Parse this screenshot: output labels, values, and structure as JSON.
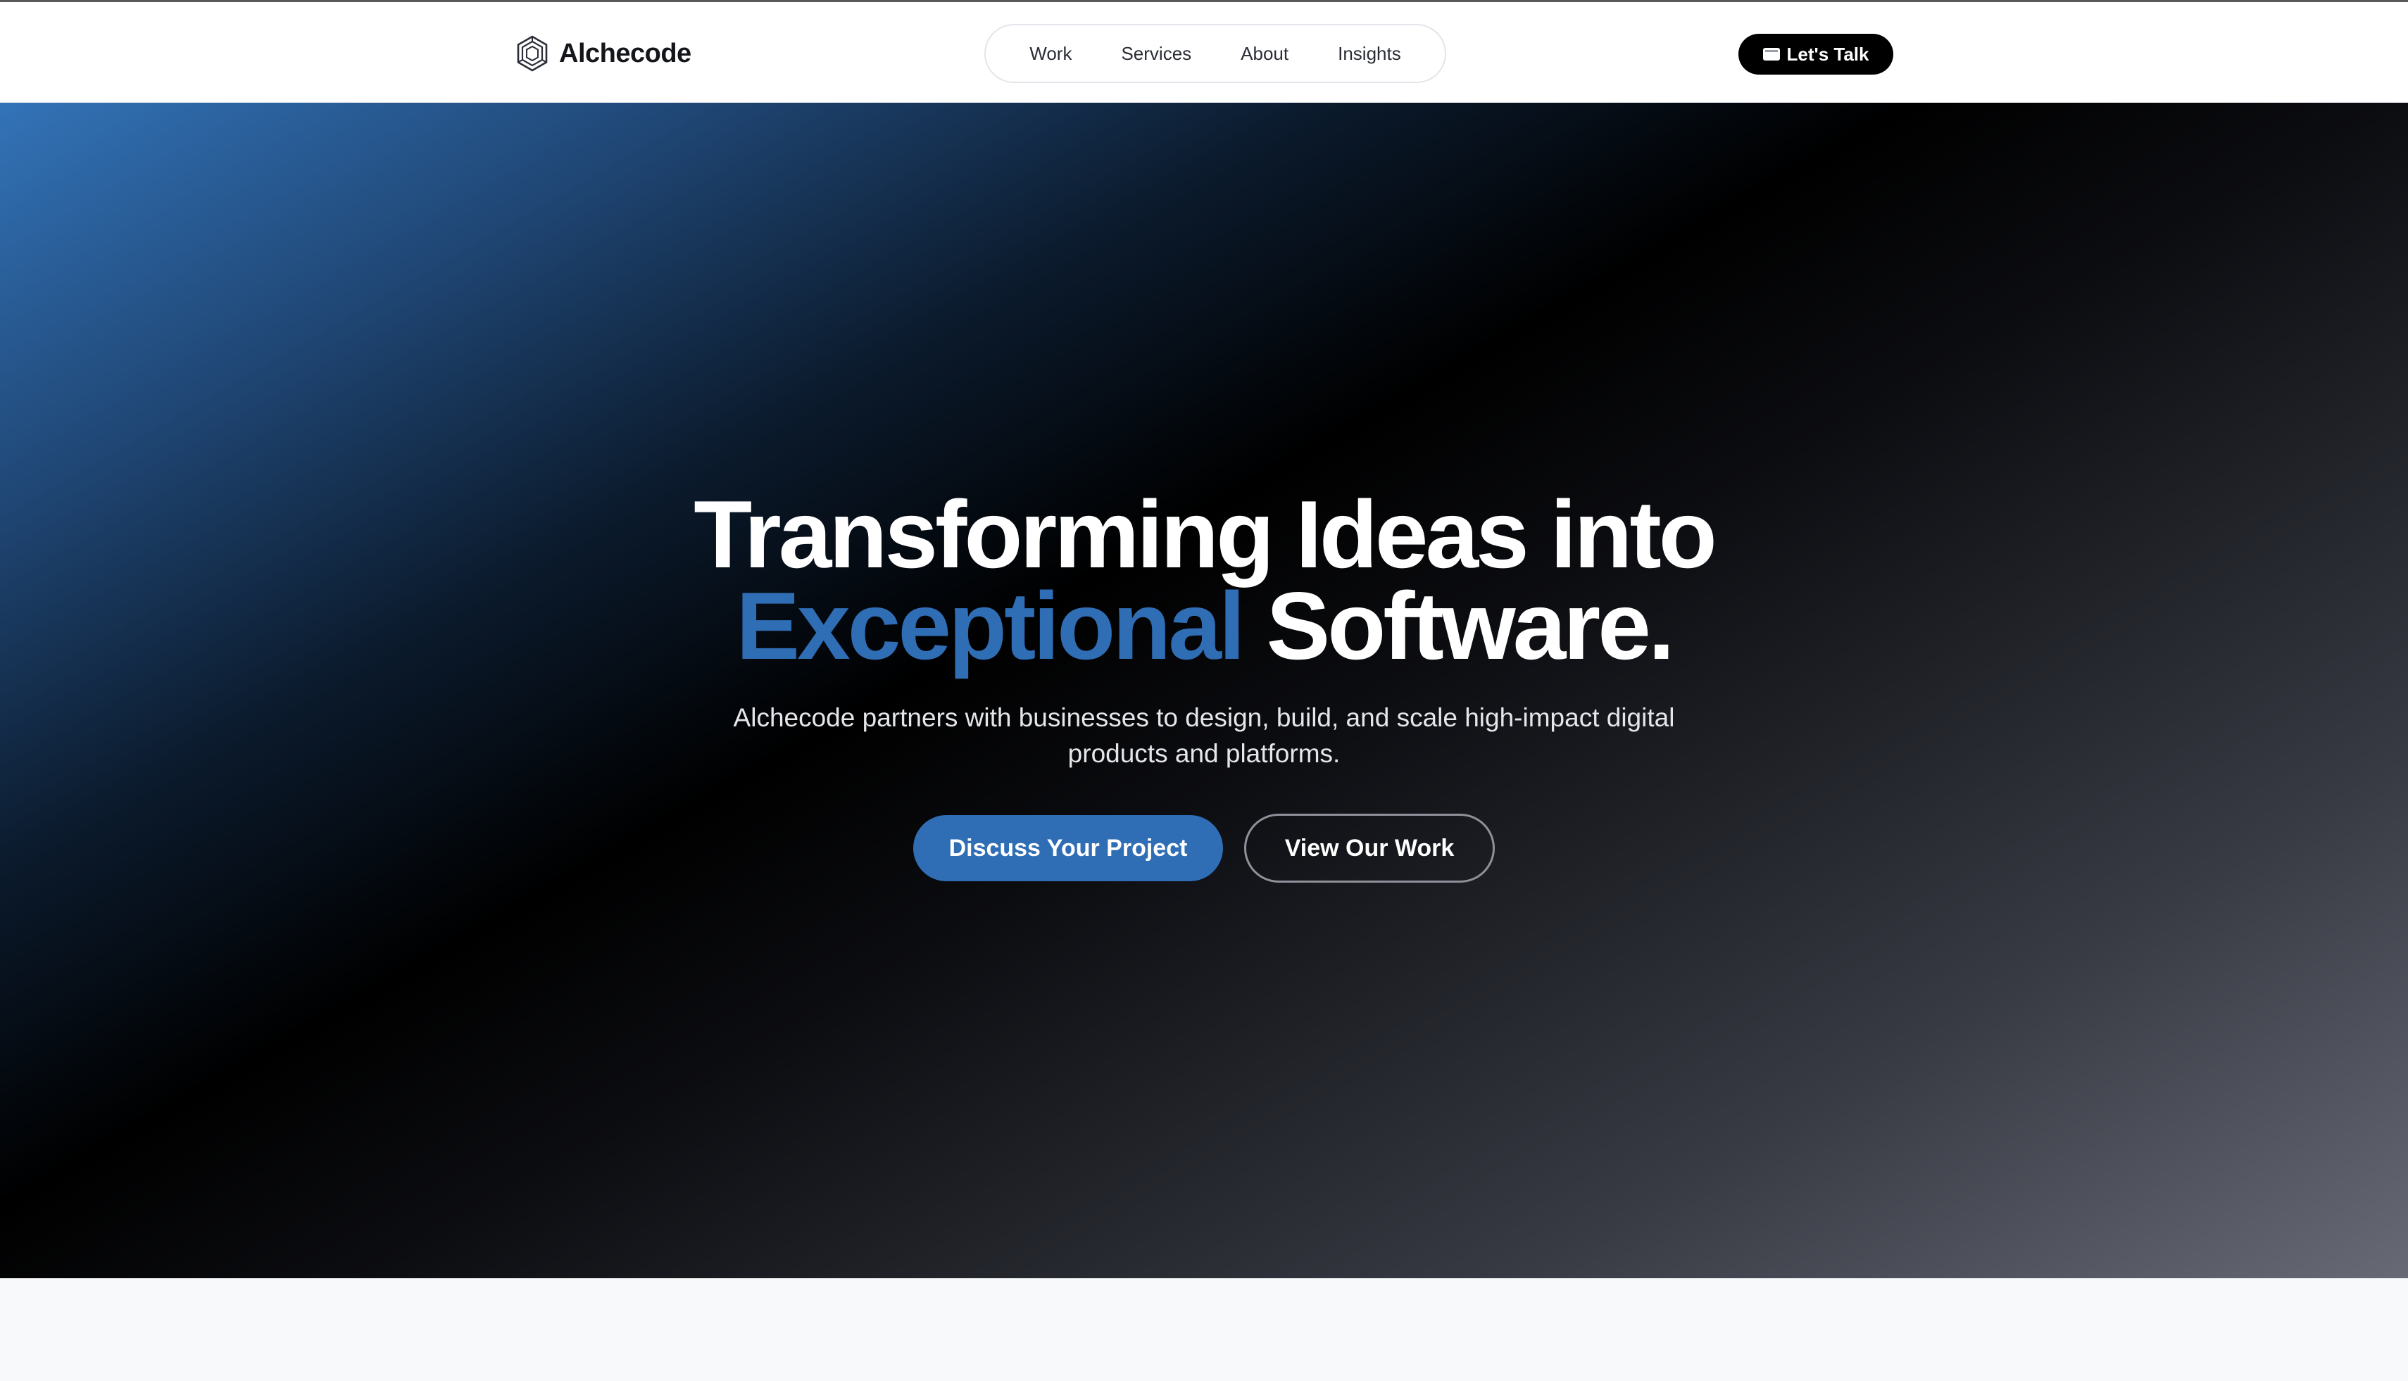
{
  "brand": {
    "name": "Alchecode",
    "logo_icon": "hexagon-logo-icon"
  },
  "nav": {
    "items": [
      {
        "label": "Work"
      },
      {
        "label": "Services"
      },
      {
        "label": "About"
      },
      {
        "label": "Insights"
      }
    ]
  },
  "header_cta": {
    "label": "Let's Talk",
    "icon": "envelope-icon"
  },
  "hero": {
    "title_line1": "Transforming Ideas into",
    "title_accent": "Exceptional",
    "title_line2_rest": "Software.",
    "subtitle": "Alchecode partners with businesses to design, build, and scale high-impact digital products and platforms.",
    "primary_button": "Discuss Your Project",
    "secondary_button": "View Our Work"
  },
  "colors": {
    "accent": "#2f6db5",
    "header_bg": "#ffffff",
    "cta_bg": "#000000",
    "hero_gradient_start": "#3373b8",
    "hero_gradient_mid": "#000000",
    "hero_gradient_end": "#676a75"
  }
}
